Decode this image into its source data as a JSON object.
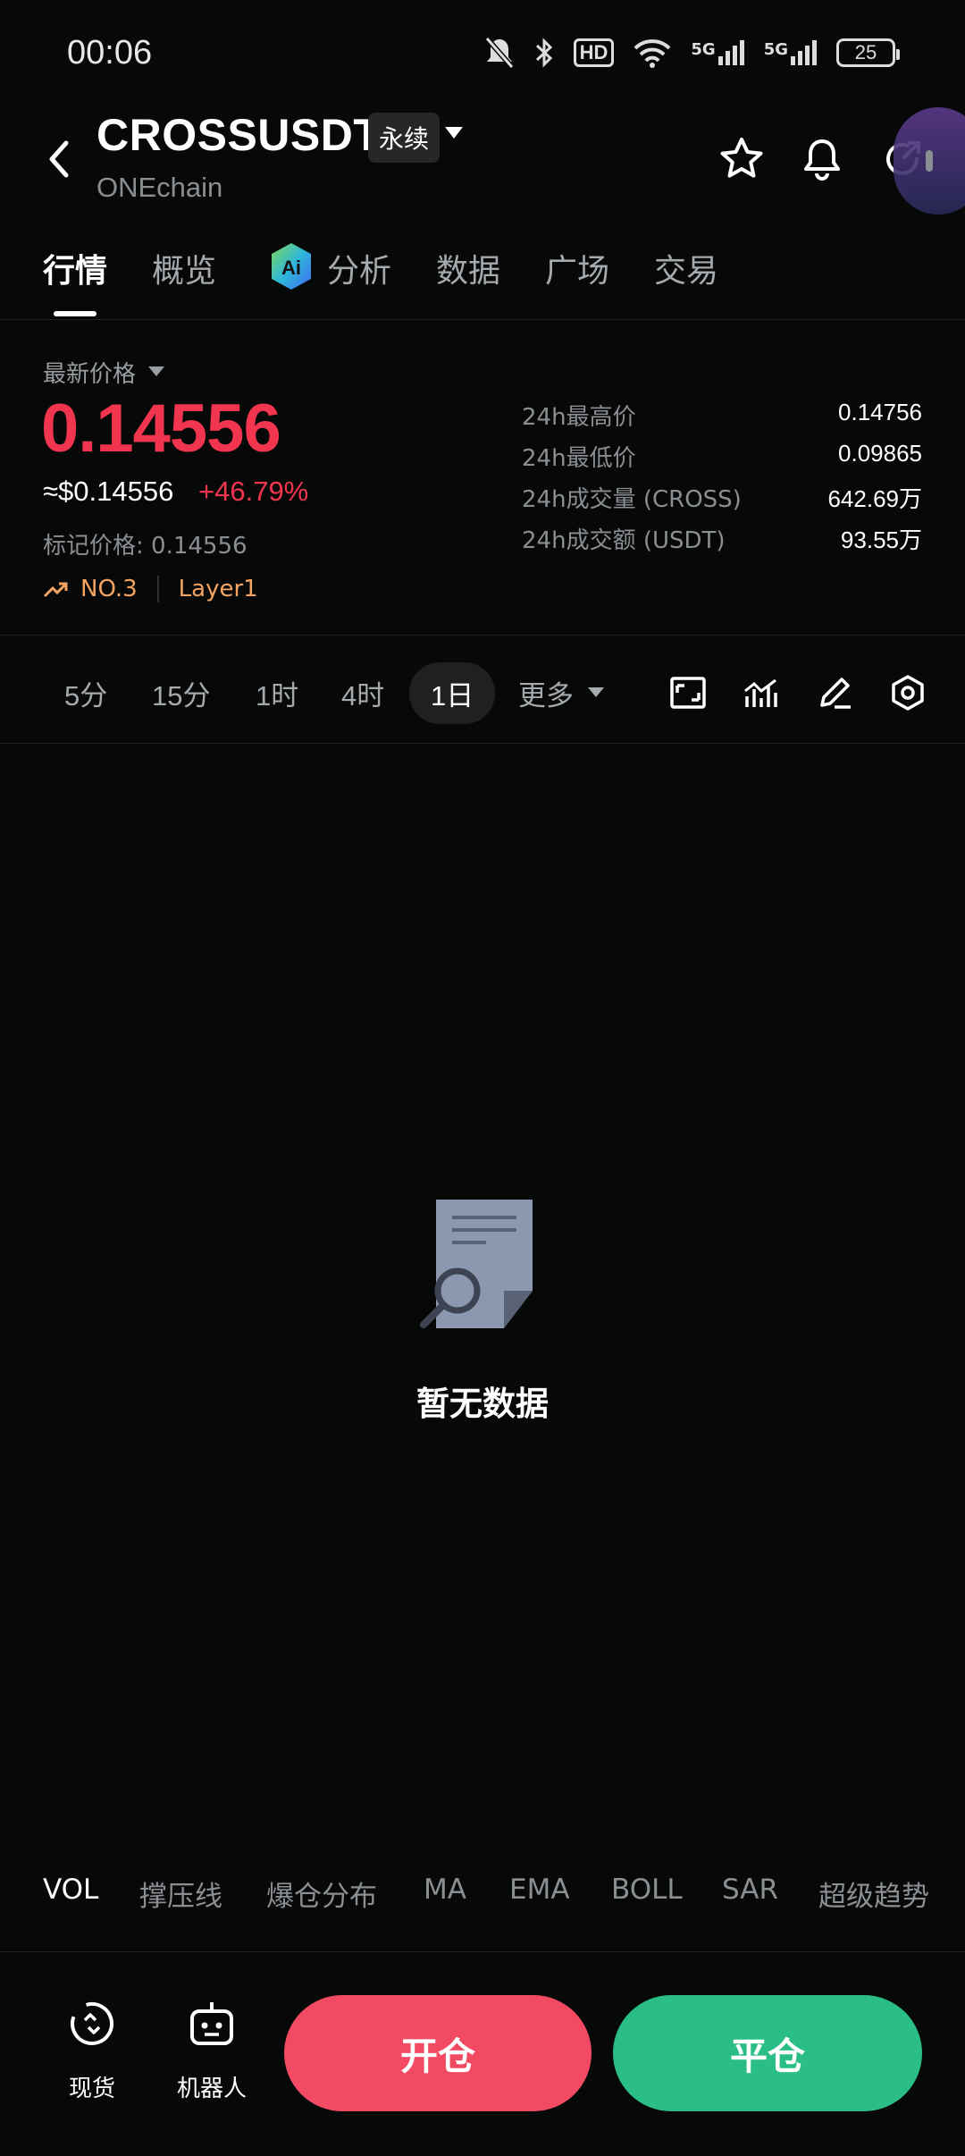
{
  "status_bar": {
    "time": "00:06",
    "hd_label": "HD",
    "net1": "5G",
    "net2": "5G",
    "battery": "25"
  },
  "header": {
    "pair": "CROSSUSDT",
    "contract_type": "永续",
    "chain": "ONEchain"
  },
  "tabs": [
    {
      "label": "行情",
      "active": true
    },
    {
      "label": "概览"
    },
    {
      "label": "分析"
    },
    {
      "label": "数据"
    },
    {
      "label": "广场"
    },
    {
      "label": "交易"
    }
  ],
  "price": {
    "latest_label": "最新价格",
    "last": "0.14556",
    "usd": "≈$0.14556",
    "change": "+46.79%",
    "mark": "标记价格: 0.14556",
    "rank": "NO.3",
    "sector": "Layer1",
    "up_color": "#f2354f",
    "down_color": "#2abd85"
  },
  "stats": [
    {
      "label": "24h最高价",
      "value": "0.14756"
    },
    {
      "label": "24h最低价",
      "value": "0.09865"
    },
    {
      "label": "24h成交量 (CROSS)",
      "value": "642.69万"
    },
    {
      "label": "24h成交额 (USDT)",
      "value": "93.55万"
    }
  ],
  "intervals": [
    "5分",
    "15分",
    "1时",
    "4时",
    "1日",
    "更多"
  ],
  "active_interval": "1日",
  "empty_state": "暂无数据",
  "indicators": [
    "VOL",
    "撑压线",
    "爆仓分布",
    "MA",
    "EMA",
    "BOLL",
    "SAR",
    "超级趋势"
  ],
  "bottom": {
    "spot": "现货",
    "bot": "机器人",
    "open": "开仓",
    "close": "平仓"
  }
}
